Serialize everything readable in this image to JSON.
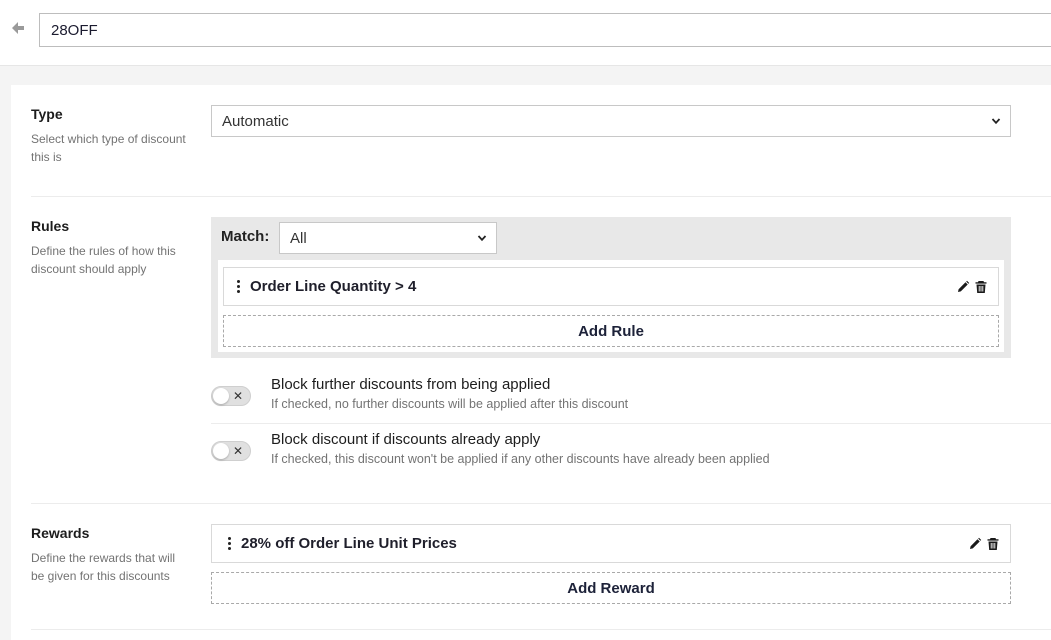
{
  "header": {
    "discount_name": "28OFF"
  },
  "type_section": {
    "title": "Type",
    "description": "Select which type of discount this is",
    "selected": "Automatic"
  },
  "rules_section": {
    "title": "Rules",
    "description": "Define the rules of how this discount should apply",
    "match_label": "Match:",
    "match_selected": "All",
    "rules": [
      {
        "label": "Order Line Quantity > 4"
      }
    ],
    "add_rule_label": "Add Rule",
    "options": [
      {
        "title": "Block further discounts from being applied",
        "description": "If checked, no further discounts will be applied after this discount",
        "checked": false
      },
      {
        "title": "Block discount if discounts already apply",
        "description": "If checked, this discount won't be applied if any other discounts have already been applied",
        "checked": false
      }
    ]
  },
  "rewards_section": {
    "title": "Rewards",
    "description": "Define the rewards that will be given for this discounts",
    "rewards": [
      {
        "label": "28% off Order Line Unit Prices"
      }
    ],
    "add_reward_label": "Add Reward"
  },
  "icons": {
    "back": "arrow-left-icon",
    "drag": "drag-handle-icon",
    "edit": "pencil-icon",
    "delete": "trash-icon",
    "dropdown": "chevron-down-icon",
    "toggle_off": "x-icon"
  }
}
